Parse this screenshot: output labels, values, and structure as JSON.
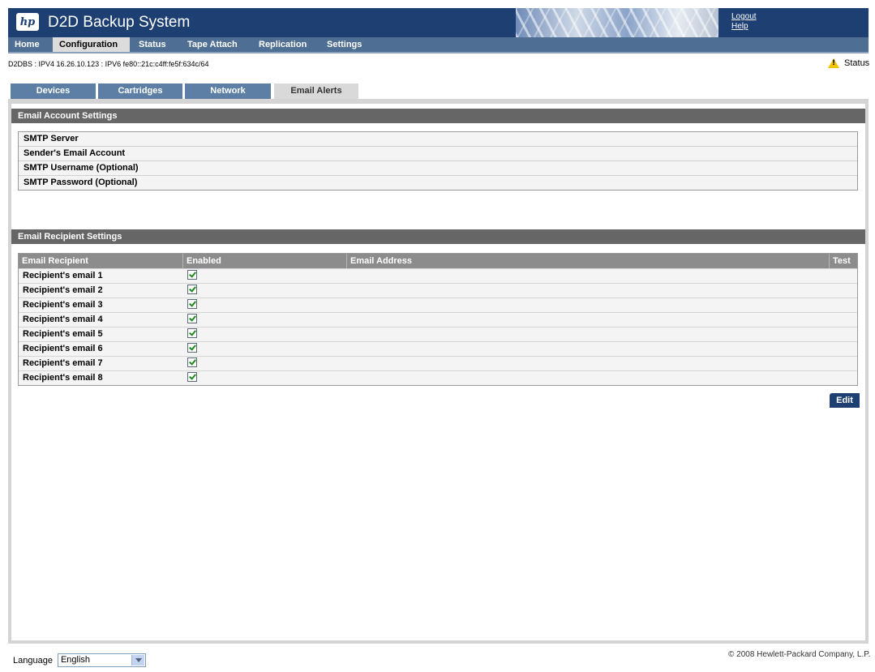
{
  "header": {
    "logo_text": "hp",
    "title": "D2D Backup System",
    "logout": "Logout",
    "help": "Help"
  },
  "nav": {
    "items": [
      {
        "label": "Home"
      },
      {
        "label": "Configuration",
        "active": true
      },
      {
        "label": "Status"
      },
      {
        "label": "Tape Attach"
      },
      {
        "label": "Replication"
      },
      {
        "label": "Settings"
      }
    ]
  },
  "status_line": "D2DBS : IPV4 16.26.10.123 : IPV6 fe80::21c:c4ff:fe5f:634c/64",
  "status_indicator": "Status",
  "subtabs": [
    {
      "label": "Devices"
    },
    {
      "label": "Cartridges"
    },
    {
      "label": "Network"
    },
    {
      "label": "Email Alerts",
      "active": true
    }
  ],
  "email_account": {
    "header": "Email Account Settings",
    "rows": [
      "SMTP Server",
      "Sender's Email Account",
      "SMTP Username (Optional)",
      "SMTP Password (Optional)"
    ]
  },
  "email_recipient": {
    "header": "Email Recipient Settings",
    "columns": [
      "Email Recipient",
      "Enabled",
      "Email Address",
      "Test"
    ],
    "rows": [
      {
        "name": "Recipient's email 1",
        "enabled": true
      },
      {
        "name": "Recipient's email 2",
        "enabled": true
      },
      {
        "name": "Recipient's email 3",
        "enabled": true
      },
      {
        "name": "Recipient's email 4",
        "enabled": true
      },
      {
        "name": "Recipient's email 5",
        "enabled": true
      },
      {
        "name": "Recipient's email 6",
        "enabled": true
      },
      {
        "name": "Recipient's email 7",
        "enabled": true
      },
      {
        "name": "Recipient's email 8",
        "enabled": true
      }
    ],
    "edit_label": "Edit"
  },
  "footer": {
    "language_label": "Language",
    "language_value": "English",
    "copyright": "© 2008 Hewlett-Packard Company, L.P."
  },
  "colors": {
    "header_bg": "#1d3f72",
    "nav_bg": "#4f6e94",
    "section_header_bg": "#666666",
    "status_icon": "#f5c400"
  },
  "icons": {
    "logo": "hp-logo-icon",
    "status": "warning-icon",
    "dropdown": "chevron-down-icon"
  }
}
